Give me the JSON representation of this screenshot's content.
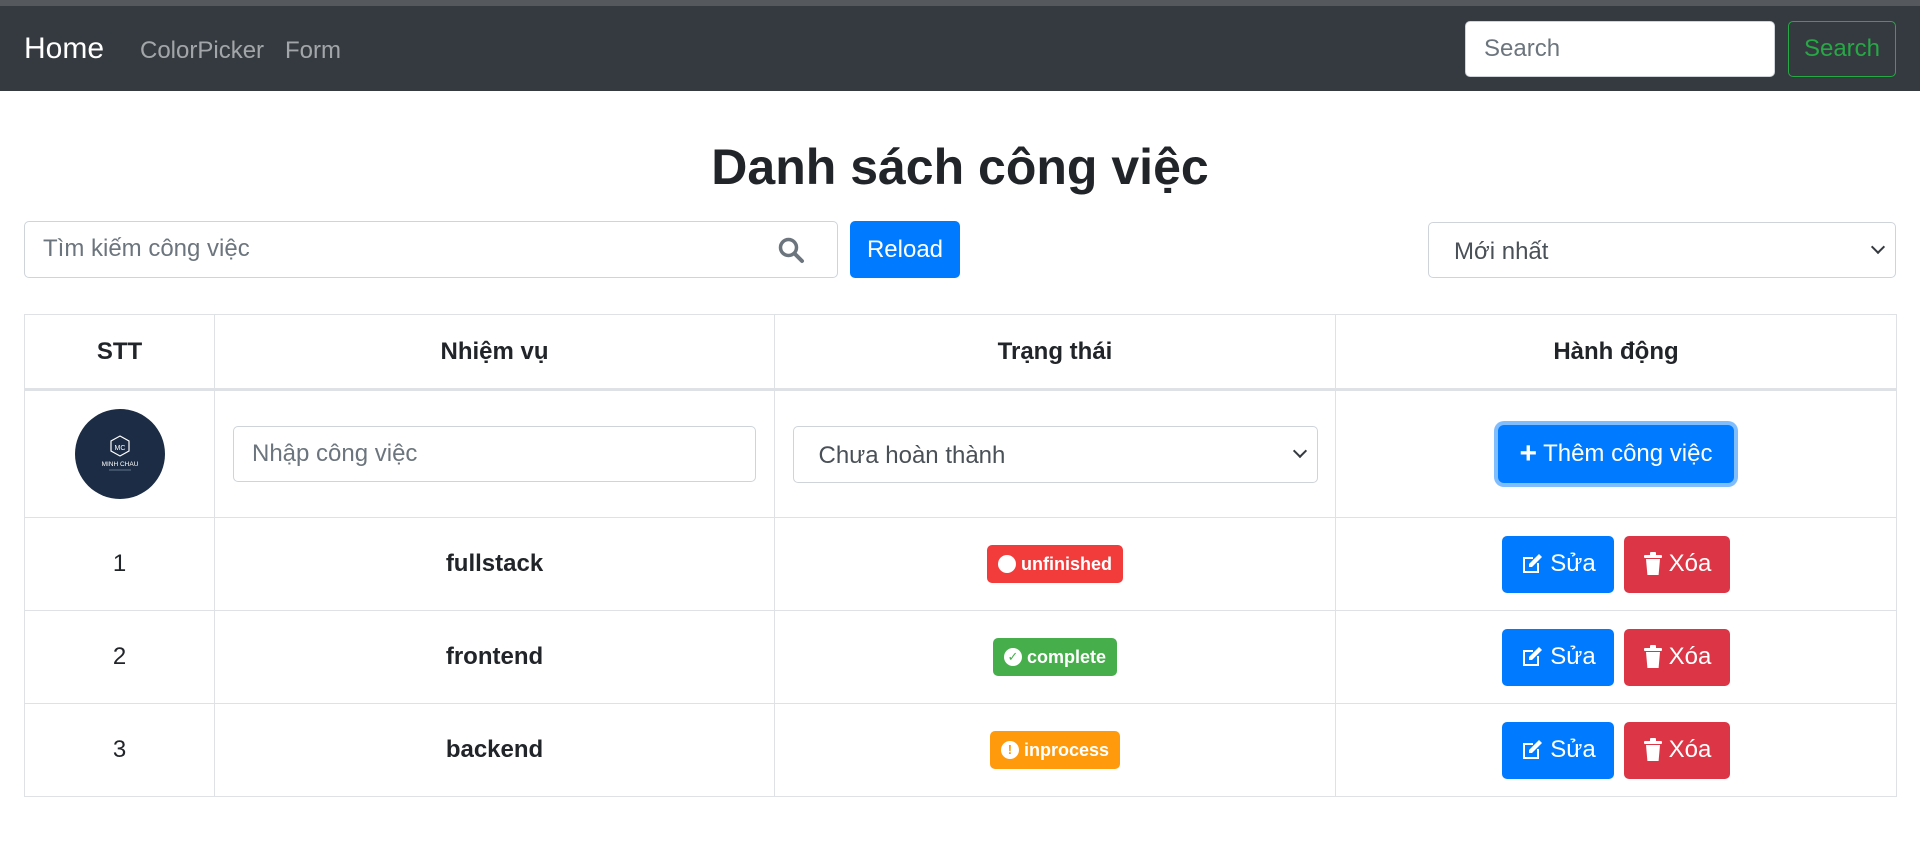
{
  "navbar": {
    "brand": "Home",
    "links": [
      "ColorPicker",
      "Form"
    ],
    "search_placeholder": "Search",
    "search_button": "Search"
  },
  "page": {
    "title": "Danh sách công việc",
    "search_placeholder": "Tìm kiếm công việc",
    "reload_button": "Reload",
    "sort_selected": "Mới nhất"
  },
  "table": {
    "headers": [
      "STT",
      "Nhiệm vụ",
      "Trạng thái",
      "Hành động"
    ],
    "add_row": {
      "logo_top": "MC",
      "logo_text": "MINH CHAU",
      "task_placeholder": "Nhập công việc",
      "status_selected": "Chưa hoàn thành",
      "add_button": "Thêm công việc"
    },
    "rows": [
      {
        "stt": "1",
        "task": "fullstack",
        "status": "unfinished",
        "status_icon": "dot-icon"
      },
      {
        "stt": "2",
        "task": "frontend",
        "status": "complete",
        "status_icon": "check-circle-icon"
      },
      {
        "stt": "3",
        "task": "backend",
        "status": "inprocess",
        "status_icon": "exclamation-circle-icon"
      }
    ],
    "edit_label": "Sửa",
    "delete_label": "Xóa"
  },
  "colors": {
    "navbar_bg": "#343a40",
    "primary": "#007bff",
    "danger": "#dc3545",
    "success": "#28a745",
    "badge_unfinished": "#f23b3b",
    "badge_complete": "#47ae4c",
    "badge_inprocess": "#ff9a0d"
  }
}
